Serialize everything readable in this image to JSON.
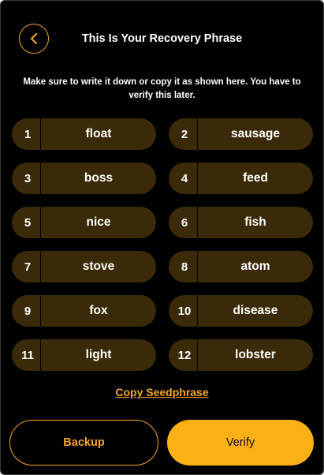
{
  "header": {
    "back_icon": "chevron-left-icon",
    "title": "This Is Your Recovery Phrase"
  },
  "instructions": "Make sure to write it down or copy it as shown here. You have to verify this later.",
  "seed_words": [
    {
      "num": "1",
      "word": "float"
    },
    {
      "num": "2",
      "word": "sausage"
    },
    {
      "num": "3",
      "word": "boss"
    },
    {
      "num": "4",
      "word": "feed"
    },
    {
      "num": "5",
      "word": "nice"
    },
    {
      "num": "6",
      "word": "fish"
    },
    {
      "num": "7",
      "word": "stove"
    },
    {
      "num": "8",
      "word": "atom"
    },
    {
      "num": "9",
      "word": "fox"
    },
    {
      "num": "10",
      "word": "disease"
    },
    {
      "num": "11",
      "word": "light"
    },
    {
      "num": "12",
      "word": "lobster"
    }
  ],
  "copy_link_label": "Copy Seedphrase",
  "actions": {
    "backup_label": "Backup",
    "verify_label": "Verify"
  },
  "colors": {
    "accent": "#f5a623",
    "pill_background": "#3a2a08",
    "verify_background": "#fbb116",
    "background": "#000000"
  }
}
